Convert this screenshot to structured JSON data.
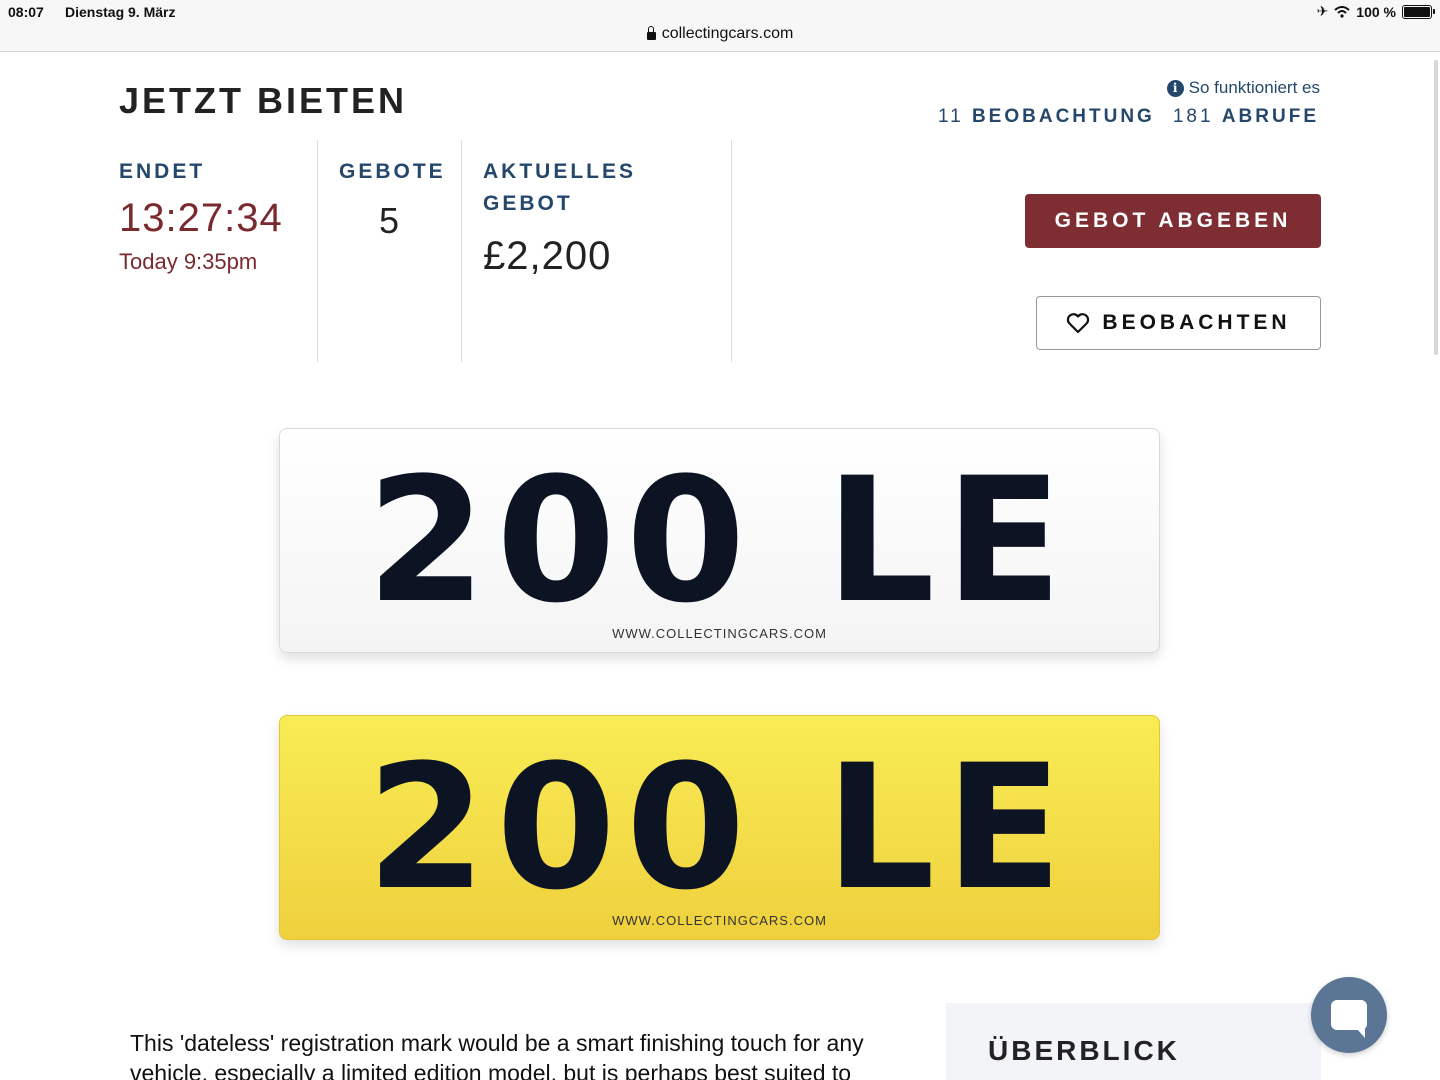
{
  "status_bar": {
    "time": "08:07",
    "date": "Dienstag 9. März",
    "battery": "100 %",
    "battery_level": 1.0,
    "url": "collectingcars.com"
  },
  "bidding": {
    "title": "JETZT BIETEN",
    "how_it_works": "So funktioniert es",
    "watch_count": "11",
    "watch_label": "BEOBACHTUNG",
    "views_count": "181",
    "views_label": "ABRUFE",
    "ends_label": "ENDET",
    "countdown": "13:27:34",
    "end_time": "Today 9:35pm",
    "bids_label": "GEBOTE",
    "bid_count": "5",
    "current_bid_label_1": "AKTUELLES",
    "current_bid_label_2": "GEBOT",
    "current_bid": "£2,200",
    "place_bid_button": "GEBOT ABGEBEN",
    "watch_button": "BEOBACHTEN"
  },
  "plates": {
    "registration": "200 LE",
    "plate_url": "WWW.COLLECTINGCARS.COM",
    "front_color": "#ffffff",
    "rear_color": "#f3dd47"
  },
  "description": {
    "text": "This 'dateless' registration mark would be a smart finishing touch for any vehicle, especially a limited edition model, but is perhaps best suited to"
  },
  "overview": {
    "title": "ÜBERBLICK"
  },
  "colors": {
    "accent_blue": "#24476b",
    "accent_red": "#7e2d33"
  }
}
